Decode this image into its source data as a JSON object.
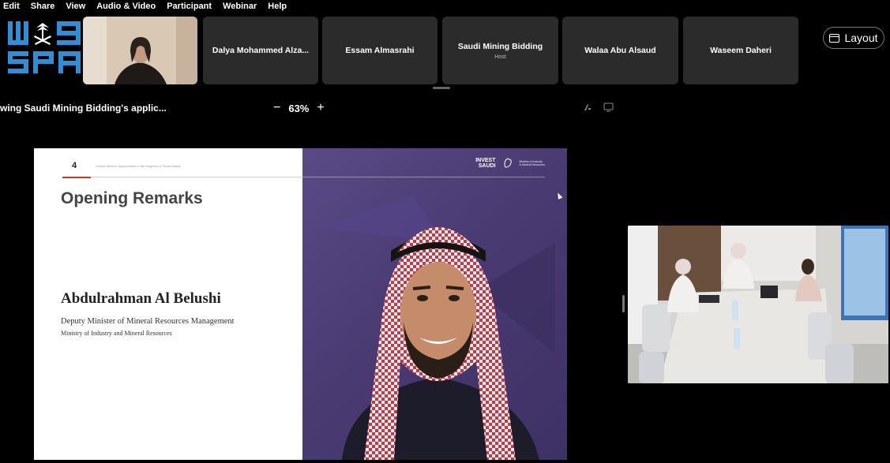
{
  "menu": {
    "items": [
      "Edit",
      "Share",
      "View",
      "Audio & Video",
      "Participant",
      "Webinar",
      "Help"
    ]
  },
  "logo": {
    "line1": "W@G",
    "line2": "SPA",
    "icon": "spa-logo"
  },
  "participants": [
    {
      "name": "Dalya Mohammed Alza...",
      "role": ""
    },
    {
      "name": "Essam Almasrahi",
      "role": ""
    },
    {
      "name": "Saudi Mining Bidding",
      "role": "Host"
    },
    {
      "name": "Walaa Abu Alsaud",
      "role": ""
    },
    {
      "name": "Waseem Daheri",
      "role": ""
    }
  ],
  "layout_button": {
    "label": "Layout",
    "icon": "layout-icon"
  },
  "toolbar": {
    "sharing_text": "wing Saudi Mining Bidding's applic...",
    "zoom_out": "−",
    "zoom_level": "63%",
    "zoom_in": "+",
    "icons": [
      "annotate-icon",
      "remote-control-icon"
    ]
  },
  "slide": {
    "number": "4",
    "caption": "Unlock Mineral Opportunities in the Kingdom of Saudi Arabia",
    "title": "Opening Remarks",
    "speaker_name": "Abdulrahman Al Belushi",
    "speaker_role": "Deputy Minister of Mineral Resources Management",
    "speaker_org": "Ministry of Industry and Mineral Resources",
    "logo_invest_line1": "INVEST",
    "logo_invest_line2": "SAUDI",
    "logo_ministry_line1": "Ministry of Industry",
    "logo_ministry_line2": "& Mineral Resources"
  },
  "colors": {
    "background": "#000000",
    "tile": "#2b2b2b",
    "slide_purple": "#4a3b73",
    "accent_red": "#c0392b"
  }
}
